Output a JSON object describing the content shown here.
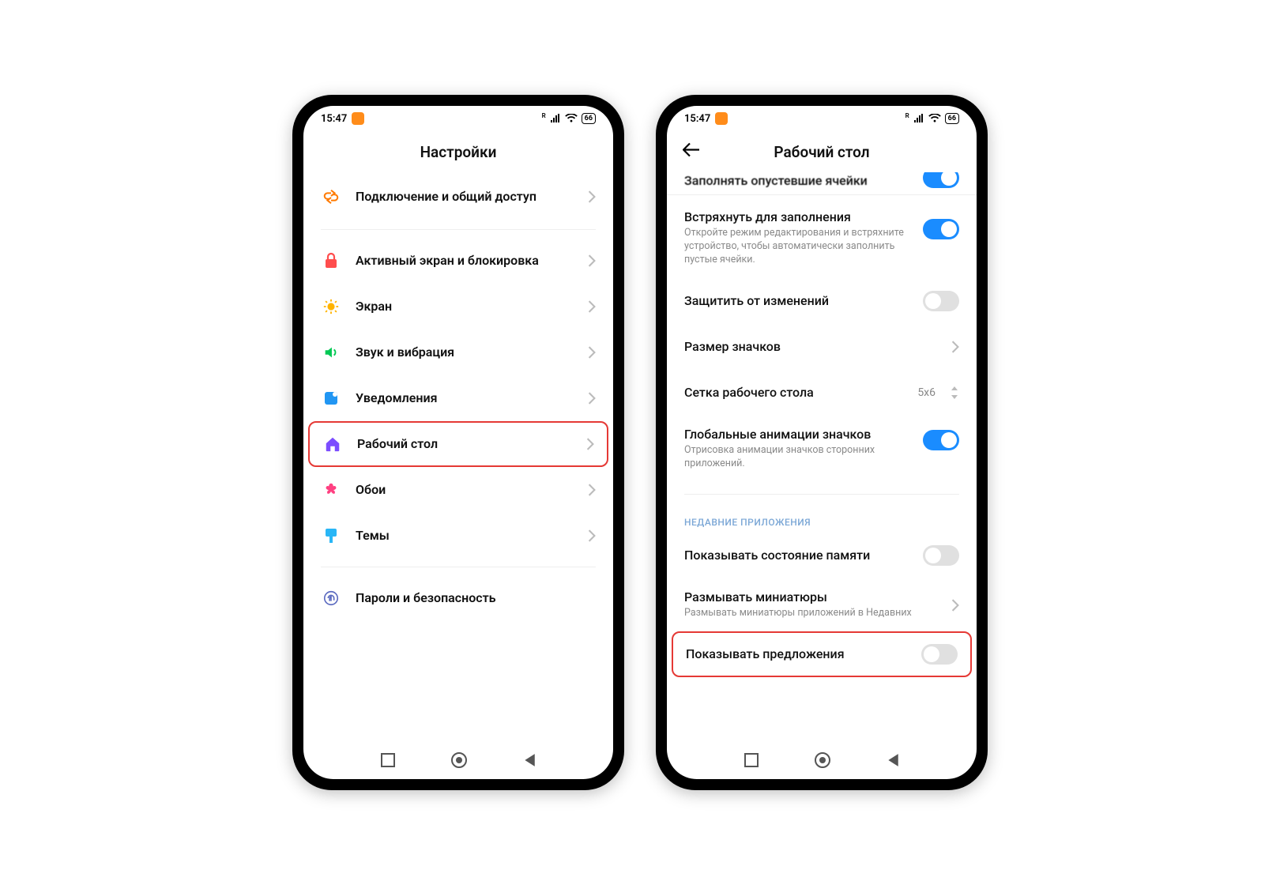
{
  "status": {
    "time": "15:47",
    "battery": "66"
  },
  "phone1": {
    "title": "Настройки",
    "rows": {
      "connection": "Подключение и общий доступ",
      "lockscreen": "Активный экран и блокировка",
      "display": "Экран",
      "sound": "Звук и вибрация",
      "notifications": "Уведомления",
      "home": "Рабочий стол",
      "wallpaper": "Обои",
      "themes": "Темы",
      "passwords": "Пароли и безопасность"
    }
  },
  "phone2": {
    "title": "Рабочий стол",
    "truncated_top": "Заполнять опустевшие ячейки",
    "shake": {
      "title": "Встряхнуть для заполнения",
      "desc": "Откройте режим редактирования и встряхните устройство, чтобы автоматически заполнить пустые ячейки."
    },
    "protect": "Защитить от изменений",
    "icon_size": "Размер значков",
    "grid": {
      "title": "Сетка рабочего стола",
      "value": "5x6"
    },
    "global_anim": {
      "title": "Глобальные анимации значков",
      "desc": "Отрисовка анимации значков сторонних приложений."
    },
    "section_recent": "НЕДАВНИЕ ПРИЛОЖЕНИЯ",
    "memory": "Показывать состояние памяти",
    "blur": {
      "title": "Размывать миниатюры",
      "desc": "Размывать миниатюры приложений в Недавних"
    },
    "suggestions": "Показывать предложения"
  }
}
